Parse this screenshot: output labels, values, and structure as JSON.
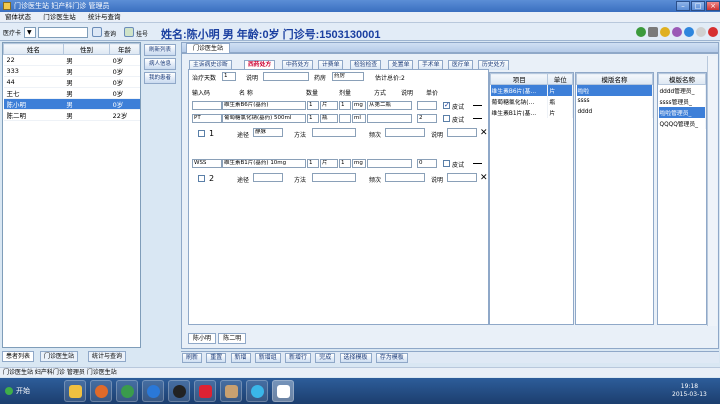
{
  "window": {
    "title": "门诊医生站  妇产科门诊  管理员"
  },
  "menu": [
    "窗体状态",
    "门诊医生站",
    "统计与查询"
  ],
  "toolbar": {
    "card_label": "医疗卡",
    "card_mode": "▼",
    "query_label": "查询",
    "register_label": "挂号"
  },
  "patient_header": "姓名:陈小明  男  年龄:0岁  门诊号:1503130001",
  "patient_list": {
    "columns": [
      "姓名",
      "性别",
      "年龄"
    ],
    "rows": [
      [
        "22",
        "男",
        "0岁"
      ],
      [
        "333",
        "男",
        "0岁"
      ],
      [
        "44",
        "男",
        "0岁"
      ],
      [
        "王七",
        "男",
        "0岁"
      ],
      [
        "陈小明",
        "男",
        "0岁"
      ],
      [
        "陈二明",
        "男",
        "22岁"
      ]
    ],
    "selected_index": 4
  },
  "side_buttons": [
    "刷新列表",
    "病人信息",
    "我的患者"
  ],
  "left_tabs": [
    "患者列表",
    "门诊医生站",
    "统计与查询"
  ],
  "main_tab": "门诊医生站",
  "rx_tabs": [
    "主诉病史诊断",
    "西药处方",
    "中药处方",
    "计费单",
    "检验检查",
    "处置单",
    "手术单",
    "医疗单",
    "历史处方"
  ],
  "rx_header": {
    "days_label": "治疗天数",
    "days_value": "1",
    "note_label": "说明",
    "pharmacy_label": "药房",
    "pharmacy_value": "药房",
    "total_label": "估计总价:2"
  },
  "rx_columns": [
    "输入码",
    "名   称",
    "数量",
    "剂量",
    "方式",
    "说明",
    "单价"
  ],
  "groups": [
    {
      "index": "1",
      "rows": [
        {
          "code": "",
          "name": "维生素B6片(基药)",
          "qty": "1",
          "unit": "片",
          "dose": "1",
          "dunit": "mg",
          "method": "从第二瓶",
          "price": "",
          "flag": "皮试",
          "checked": true
        },
        {
          "code": "PT",
          "name": "葡萄糖氯化钠(基药) 500ml",
          "qty": "1",
          "unit": "瓶",
          "dose": "",
          "dunit": "ml",
          "method": "",
          "price": "2",
          "flag": "皮试",
          "checked": false
        }
      ],
      "route_label": "途径",
      "route_value": "静脉",
      "method_label": "方法",
      "freq_label": "频次",
      "note_label": "说明"
    },
    {
      "index": "2",
      "rows": [
        {
          "code": "WSS",
          "name": "维生素B1片(基药) 10mg",
          "qty": "1",
          "unit": "片",
          "dose": "1",
          "dunit": "mg",
          "method": "",
          "price": "0",
          "flag": "皮试",
          "checked": false
        }
      ],
      "route_label": "途径",
      "route_value": "",
      "method_label": "方法",
      "freq_label": "频次",
      "note_label": "说明"
    }
  ],
  "item_grid": {
    "columns": [
      "项目",
      "单位"
    ],
    "rows": [
      [
        "维生素B6片(基…",
        "片"
      ],
      [
        "葡萄糖氯化钠(…",
        "瓶"
      ],
      [
        "维生素B1片(基…",
        "片"
      ]
    ],
    "selected_index": 0
  },
  "template_grid1": {
    "columns": [
      "模版名称"
    ],
    "rows": [
      [
        "啦啦"
      ],
      [
        "ssss"
      ],
      [
        "dddd"
      ]
    ],
    "selected_index": 0
  },
  "template_grid2": {
    "columns": [
      "模版名称"
    ],
    "rows": [
      [
        "dddd管理员_"
      ],
      [
        "ssss管理员_"
      ],
      [
        "啦啦管理员_"
      ],
      [
        "QQQQ管理员_"
      ]
    ],
    "selected_index": 2
  },
  "sub_tabs": [
    "陈小明",
    "陈二明"
  ],
  "actions": [
    "刷新",
    "重置",
    "新增",
    "新增组",
    "新增行",
    "完成",
    "选择模板",
    "存为模板"
  ],
  "status_text": "门诊医生站  妇产科门诊  管理员  门诊医生站",
  "taskbar": {
    "start": "开始",
    "time": "19:18",
    "date": "2015-03-13"
  },
  "colors": {
    "selection": "#3d7fd8",
    "header_text": "#1a3fa0",
    "accent_red": "#cc0033"
  }
}
